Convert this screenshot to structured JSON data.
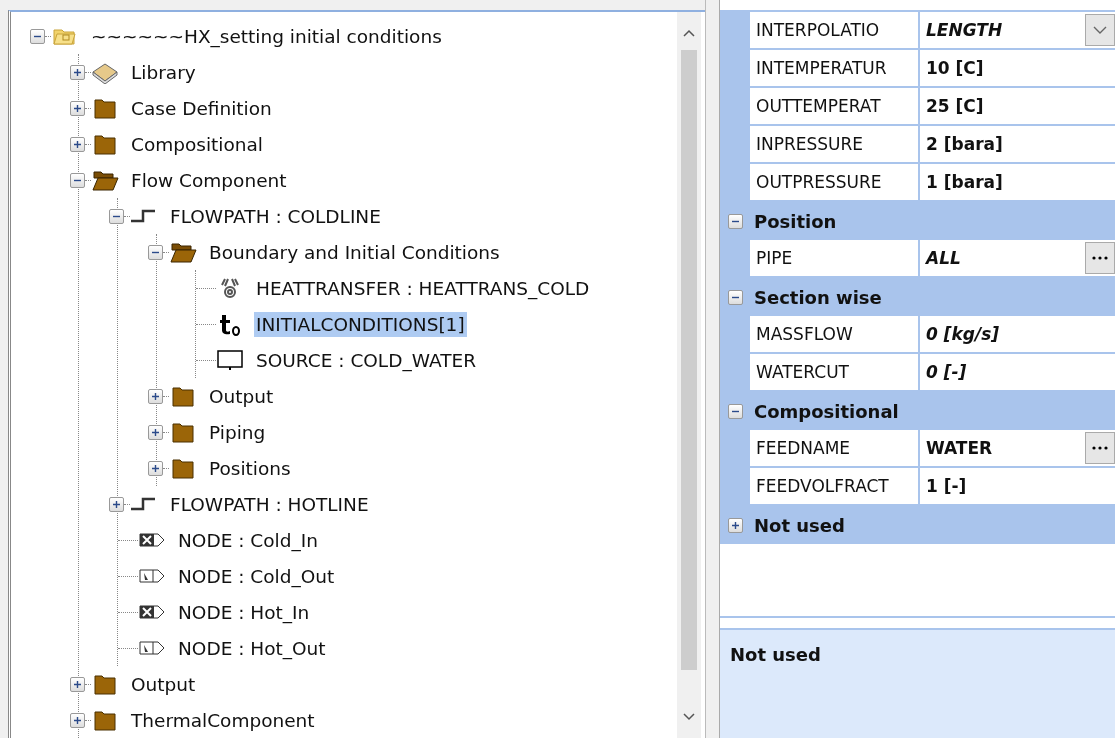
{
  "tree": [
    {
      "label": "~~~~~~HX_setting initial conditions",
      "kind": "project",
      "expanded": true,
      "selected": false,
      "children": [
        {
          "label": "Library",
          "kind": "book",
          "expanded": false,
          "selected": false
        },
        {
          "label": "Case Definition",
          "kind": "folder",
          "expanded": false,
          "selected": false
        },
        {
          "label": "Compositional",
          "kind": "folder",
          "expanded": false,
          "selected": false
        },
        {
          "label": "Flow Component",
          "kind": "folder-open",
          "expanded": true,
          "selected": false,
          "children": [
            {
              "label": "FLOWPATH : COLDLINE",
              "kind": "flowpath",
              "expanded": true,
              "selected": false,
              "children": [
                {
                  "label": "Boundary and Initial Conditions",
                  "kind": "folder-open",
                  "expanded": true,
                  "selected": false,
                  "children": [
                    {
                      "label": "HEATTRANSFER : HEATTRANS_COLD",
                      "kind": "heat",
                      "selected": false
                    },
                    {
                      "label": "INITIALCONDITIONS[1]",
                      "kind": "initial",
                      "selected": true
                    },
                    {
                      "label": "SOURCE : COLD_WATER",
                      "kind": "source",
                      "selected": false
                    }
                  ]
                },
                {
                  "label": "Output",
                  "kind": "folder",
                  "expanded": false,
                  "selected": false
                },
                {
                  "label": "Piping",
                  "kind": "folder",
                  "expanded": false,
                  "selected": false
                },
                {
                  "label": "Positions",
                  "kind": "folder",
                  "expanded": false,
                  "selected": false
                }
              ]
            },
            {
              "label": "FLOWPATH : HOTLINE",
              "kind": "flowpath",
              "expanded": false,
              "selected": false
            },
            {
              "label": "NODE : Cold_In",
              "kind": "node-in",
              "selected": false
            },
            {
              "label": "NODE : Cold_Out",
              "kind": "node-out",
              "selected": false
            },
            {
              "label": "NODE : Hot_In",
              "kind": "node-in",
              "selected": false
            },
            {
              "label": "NODE : Hot_Out",
              "kind": "node-out",
              "selected": false
            }
          ]
        },
        {
          "label": "Output",
          "kind": "folder",
          "expanded": false,
          "selected": false
        },
        {
          "label": "ThermalComponent",
          "kind": "folder",
          "expanded": false,
          "selected": false
        }
      ]
    }
  ],
  "grid": [
    {
      "kind": "dropdown",
      "name": "INTERPOLATIO",
      "value": "LENGTH",
      "italic": true
    },
    {
      "kind": "text",
      "name": "INTEMPERATUR",
      "value": "10 [C]",
      "italic": false
    },
    {
      "kind": "text",
      "name": "OUTTEMPERAT",
      "value": "25 [C]",
      "italic": false
    },
    {
      "kind": "text",
      "name": "INPRESSURE",
      "value": "2 [bara]",
      "italic": false
    },
    {
      "kind": "text",
      "name": "OUTPRESSURE",
      "value": "1 [bara]",
      "italic": false
    },
    {
      "kind": "category",
      "label": "Position",
      "expanded": true
    },
    {
      "kind": "ellipsis",
      "name": "PIPE",
      "value": "ALL",
      "italic": true
    },
    {
      "kind": "category",
      "label": "Section wise",
      "expanded": true
    },
    {
      "kind": "text",
      "name": "MASSFLOW",
      "value": "0 [kg/s]",
      "italic": true
    },
    {
      "kind": "text",
      "name": "WATERCUT",
      "value": "0 [-]",
      "italic": true
    },
    {
      "kind": "category",
      "label": "Compositional",
      "expanded": true
    },
    {
      "kind": "ellipsis",
      "name": "FEEDNAME",
      "value": "WATER",
      "italic": false
    },
    {
      "kind": "text",
      "name": "FEEDVOLFRACT",
      "value": "1 [-]",
      "italic": false
    },
    {
      "kind": "category",
      "label": "Not used",
      "expanded": false
    }
  ],
  "description": {
    "title": "Not used"
  }
}
